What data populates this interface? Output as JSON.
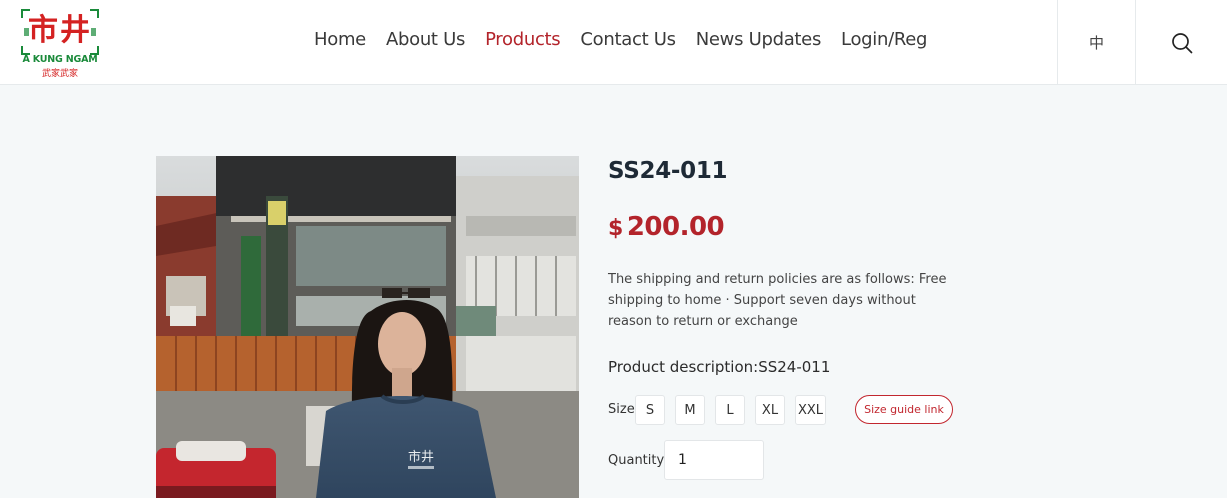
{
  "brand": {
    "logo_zh": "市井",
    "logo_en": "A KUNG NGAM",
    "logo_sub": "武家武家"
  },
  "nav": {
    "items": [
      {
        "label": "Home",
        "active": false
      },
      {
        "label": "About Us",
        "active": false
      },
      {
        "label": "Products",
        "active": true
      },
      {
        "label": "Contact Us",
        "active": false
      },
      {
        "label": "News Updates",
        "active": false
      },
      {
        "label": "Login/Reg",
        "active": false
      }
    ],
    "lang_label": "中",
    "search_icon": "search-icon"
  },
  "product": {
    "title": "SS24-011",
    "currency": "$",
    "price": "200.00",
    "policy": "The shipping and return policies are as follows: Free shipping to home · Support seven days without reason to return or exchange",
    "description_label": "Product description:",
    "description_value": "SS24-011",
    "size_label": "Size:",
    "sizes": [
      "S",
      "M",
      "L",
      "XL",
      "XXL"
    ],
    "size_guide": "Size guide link",
    "quantity_label": "Quantity:",
    "quantity_value": "1"
  },
  "colors": {
    "accent": "#b3242b",
    "logo_green": "#1a8a3a",
    "logo_red": "#d42222",
    "page_bg": "#f5f8f9"
  }
}
